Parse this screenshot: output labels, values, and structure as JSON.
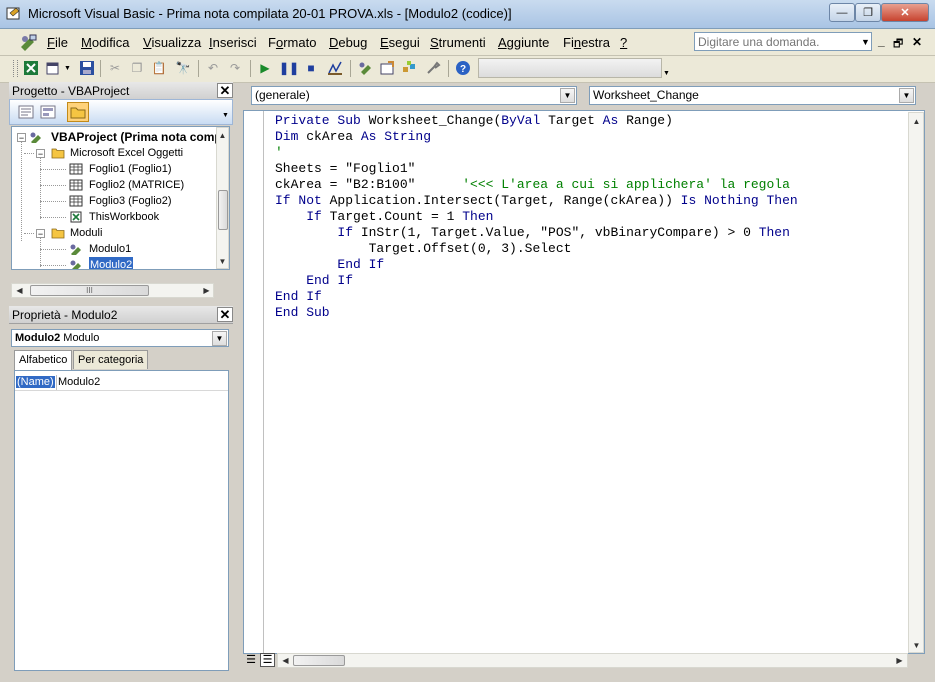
{
  "window": {
    "title": "Microsoft Visual Basic - Prima nota compilata 20-01 PROVA.xls - [Modulo2 (codice)]",
    "minimize": "—",
    "restore": "❐",
    "close": "✕"
  },
  "menubar": {
    "items": [
      {
        "label": "File",
        "u": "F",
        "rest": "ile"
      },
      {
        "label": "Modifica",
        "u": "M",
        "rest": "odifica"
      },
      {
        "label": "Visualizza",
        "u": "V",
        "rest": "isualizza"
      },
      {
        "label": "Inserisci",
        "u": "I",
        "rest": "nserisci"
      },
      {
        "label": "Formato",
        "pre": "F",
        "u": "o",
        "rest": "rmato"
      },
      {
        "label": "Debug",
        "u": "D",
        "rest": "ebug"
      },
      {
        "label": "Esegui",
        "u": "E",
        "rest": "segui"
      },
      {
        "label": "Strumenti",
        "u": "S",
        "rest": "trumenti"
      },
      {
        "label": "Aggiunte",
        "u": "A",
        "rest": "ggiunte"
      },
      {
        "label": "Finestra",
        "pre": "Fi",
        "u": "n",
        "rest": "estra"
      },
      {
        "label": "?",
        "u": "?",
        "rest": ""
      }
    ],
    "help_placeholder": "Digitare una domanda.",
    "mdi_min": "_",
    "mdi_restore": "🗗",
    "mdi_close": "✕"
  },
  "project_pane": {
    "title": "Progetto - VBAProject",
    "close": "✕",
    "tree": {
      "root": "VBAProject (Prima nota comp",
      "excel_objects": "Microsoft Excel Oggetti",
      "sheets": [
        "Foglio1 (Foglio1)",
        "Foglio2 (MATRICE)",
        "Foglio3 (Foglio2)"
      ],
      "workbook": "ThisWorkbook",
      "modules_folder": "Moduli",
      "modules": [
        "Modulo1",
        "Modulo2"
      ],
      "selected": "Modulo2"
    },
    "hscroll_thumb_grip": "III"
  },
  "properties_pane": {
    "title": "Proprietà - Modulo2",
    "close": "✕",
    "object_name": "Modulo2",
    "object_type": "Modulo",
    "tabs": [
      "Alfabetico",
      "Per categoria"
    ],
    "active_tab": "Alfabetico",
    "rows": [
      {
        "name": "(Name)",
        "value": "Modulo2"
      }
    ]
  },
  "code_window": {
    "object_combo": "(generale)",
    "procedure_combo": "Worksheet_Change",
    "lines": [
      [
        {
          "t": "Private Sub ",
          "c": "kw"
        },
        {
          "t": "Worksheet_Change(",
          "c": "tx"
        },
        {
          "t": "ByVal ",
          "c": "kw"
        },
        {
          "t": "Target ",
          "c": "tx"
        },
        {
          "t": "As ",
          "c": "kw"
        },
        {
          "t": "Range)",
          "c": "tx"
        }
      ],
      [
        {
          "t": "Dim ",
          "c": "kw"
        },
        {
          "t": "ckArea ",
          "c": "tx"
        },
        {
          "t": "As String",
          "c": "kw"
        }
      ],
      [
        {
          "t": "'",
          "c": "cm"
        }
      ],
      [
        {
          "t": "Sheets = \"Foglio1\"",
          "c": "tx"
        }
      ],
      [
        {
          "t": "ckArea = \"B2:B100\"      ",
          "c": "tx"
        },
        {
          "t": "'<<< L'area a cui si applichera' la regola",
          "c": "cm"
        }
      ],
      [
        {
          "t": "If Not ",
          "c": "kw"
        },
        {
          "t": "Application.Intersect(Target, Range(ckArea)) ",
          "c": "tx"
        },
        {
          "t": "Is Nothing Then",
          "c": "kw"
        }
      ],
      [
        {
          "t": "    If ",
          "c": "kw"
        },
        {
          "t": "Target.Count = 1 ",
          "c": "tx"
        },
        {
          "t": "Then",
          "c": "kw"
        }
      ],
      [
        {
          "t": "        If ",
          "c": "kw"
        },
        {
          "t": "InStr(1, Target.Value, \"POS\", vbBinaryCompare) > 0 ",
          "c": "tx"
        },
        {
          "t": "Then",
          "c": "kw"
        }
      ],
      [
        {
          "t": "            Target.Offset(0, 3).Select",
          "c": "tx"
        }
      ],
      [
        {
          "t": "        End If",
          "c": "kw"
        }
      ],
      [
        {
          "t": "    End If",
          "c": "kw"
        }
      ],
      [
        {
          "t": "End If",
          "c": "kw"
        }
      ],
      [
        {
          "t": "End Sub",
          "c": "kw"
        }
      ]
    ]
  },
  "colors": {
    "keyword": "#00008b",
    "comment": "#008000",
    "selection": "#316ac5"
  }
}
